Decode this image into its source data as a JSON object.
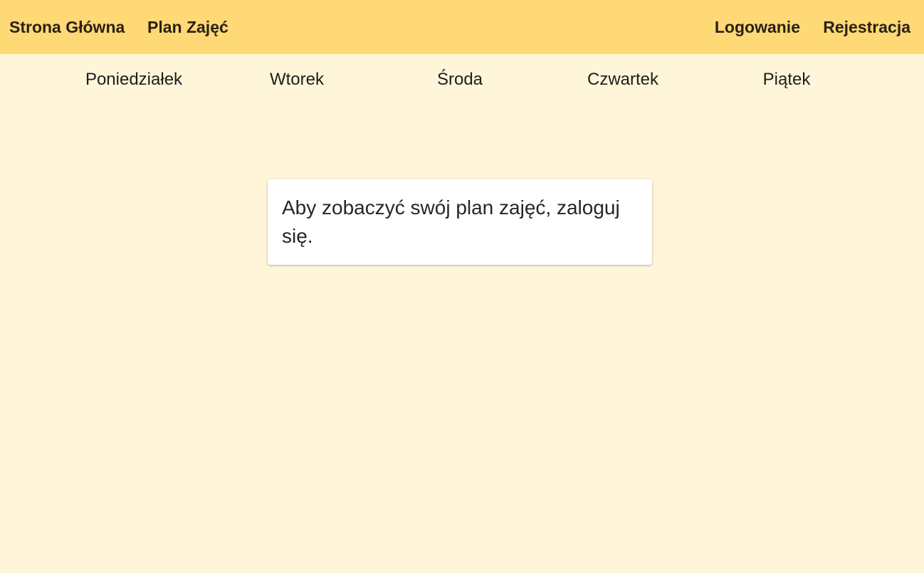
{
  "header": {
    "nav_left": {
      "home_label": "Strona Główna",
      "plan_label": "Plan Zajęć"
    },
    "nav_right": {
      "login_label": "Logowanie",
      "register_label": "Rejestracja"
    }
  },
  "days": [
    {
      "label": "Poniedziałek"
    },
    {
      "label": "Wtorek"
    },
    {
      "label": "Środa"
    },
    {
      "label": "Czwartek"
    },
    {
      "label": "Piątek"
    }
  ],
  "notice": {
    "message": "Aby zobaczyć swój plan zajęć, zaloguj się."
  },
  "colors": {
    "header_bg": "#FFD975",
    "page_bg": "#FFF5D9",
    "card_bg": "#FFFFFF"
  }
}
